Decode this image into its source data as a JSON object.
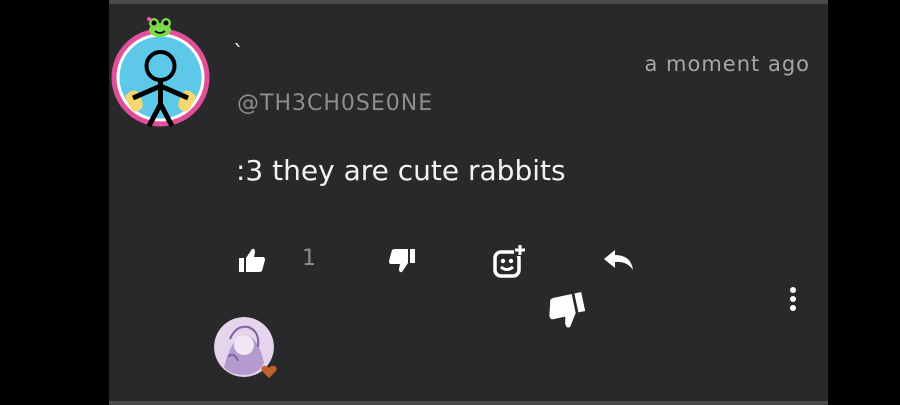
{
  "comment": {
    "display_name": "`",
    "handle": "@TH3CH0SE0NE",
    "timestamp": "a moment ago",
    "text": ":3 they are cute rabbits",
    "like_count": "1"
  },
  "icons": {
    "avatar": "stick-figure-avatar",
    "badge": "frog-icon",
    "like": "thumbs-up-icon",
    "dislike": "thumbs-down-icon",
    "award": "add-reaction-icon",
    "reply": "reply-icon",
    "floating": "thumbs-down-icon",
    "menu": "more-vertical-icon",
    "reply_avatar": "user-avatar",
    "heart": "heart-icon"
  },
  "colors": {
    "background": "#29292b",
    "text_primary": "#f2f2f2",
    "text_secondary": "#8e8e90",
    "avatar_ring": "#e0509a",
    "avatar_fill": "#5ec8e8"
  }
}
